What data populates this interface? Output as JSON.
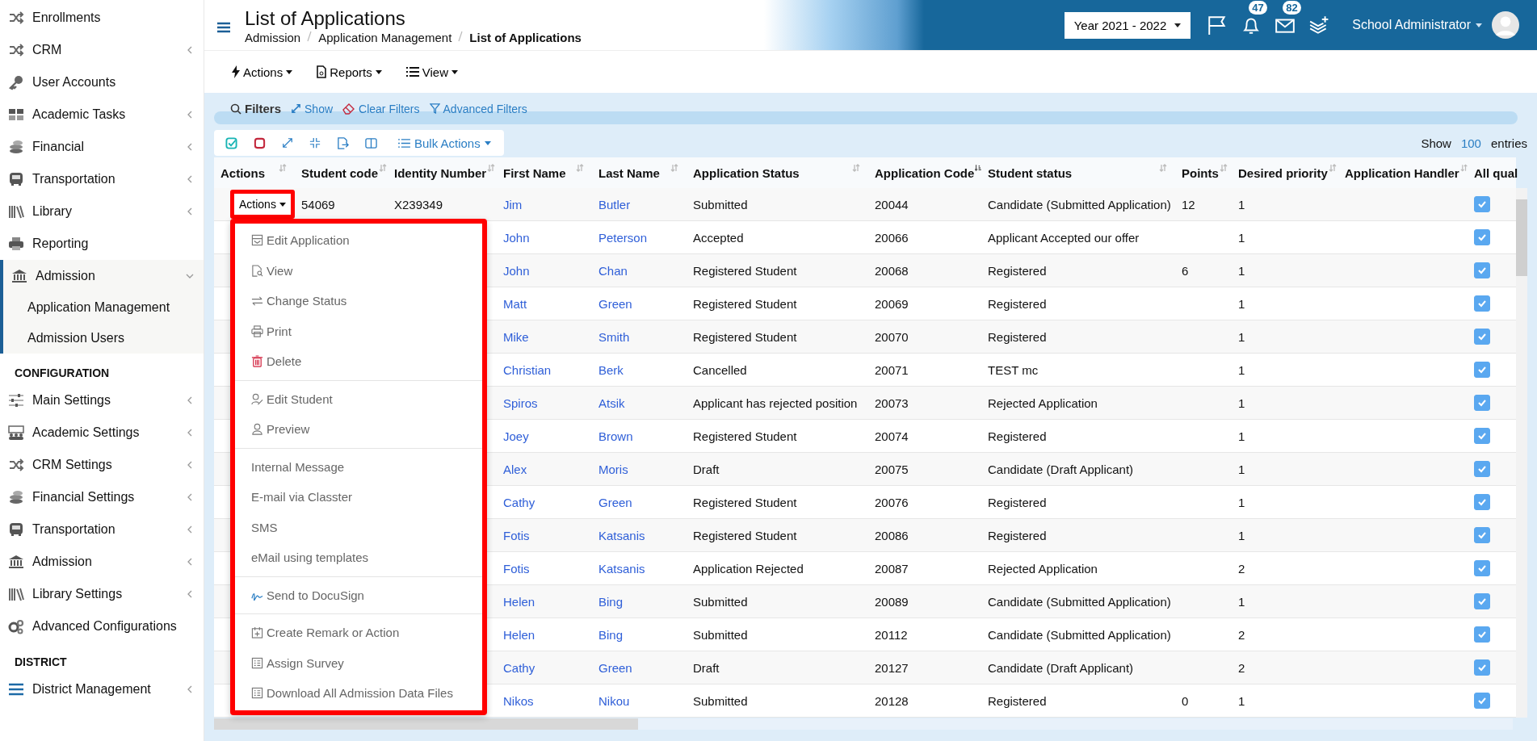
{
  "sidebar": {
    "sections": [
      {
        "items": [
          {
            "label": "Enrollments",
            "kind": "link"
          },
          {
            "label": "CRM",
            "kind": "group",
            "expanded": false
          },
          {
            "label": "User Accounts",
            "kind": "link"
          },
          {
            "label": "Academic Tasks",
            "kind": "group",
            "expanded": false
          },
          {
            "label": "Financial",
            "kind": "group",
            "expanded": false
          },
          {
            "label": "Transportation",
            "kind": "group",
            "expanded": false
          },
          {
            "label": "Library",
            "kind": "group",
            "expanded": false
          },
          {
            "label": "Reporting",
            "kind": "link"
          },
          {
            "label": "Admission",
            "kind": "group",
            "expanded": true,
            "children": [
              {
                "label": "Application Management"
              },
              {
                "label": "Admission Users"
              }
            ]
          }
        ]
      },
      {
        "heading": "CONFIGURATION",
        "items": [
          {
            "label": "Main Settings",
            "kind": "group",
            "expanded": false
          },
          {
            "label": "Academic Settings",
            "kind": "group",
            "expanded": false
          },
          {
            "label": "CRM Settings",
            "kind": "group",
            "expanded": false
          },
          {
            "label": "Financial Settings",
            "kind": "group",
            "expanded": false
          },
          {
            "label": "Transportation",
            "kind": "group",
            "expanded": false
          },
          {
            "label": "Admission",
            "kind": "group",
            "expanded": false
          },
          {
            "label": "Library Settings",
            "kind": "group",
            "expanded": false
          },
          {
            "label": "Advanced Configurations",
            "kind": "link"
          }
        ]
      },
      {
        "heading": "DISTRICT",
        "items": [
          {
            "label": "District Management",
            "kind": "group",
            "expanded": false
          }
        ]
      }
    ]
  },
  "header": {
    "title": "List of Applications",
    "breadcrumb": [
      {
        "label": "Admission",
        "current": false
      },
      {
        "label": "Application Management",
        "current": false
      },
      {
        "label": "List of Applications",
        "current": true
      }
    ],
    "year": "Year 2021 - 2022",
    "notifications": "47",
    "messages": "82",
    "user": "School Administrator"
  },
  "toolbar": [
    "Actions",
    "Reports",
    "View"
  ],
  "filters": {
    "label": "Filters",
    "links": [
      "Show",
      "Clear Filters",
      "Advanced Filters"
    ]
  },
  "bulk_actions": "Bulk Actions",
  "page_size": {
    "before": "Show",
    "value": "100",
    "after": "entries"
  },
  "table": {
    "columns": [
      {
        "label": "Actions",
        "sortable": true,
        "sorted": false
      },
      {
        "label": "Student code",
        "sortable": true,
        "sorted": false
      },
      {
        "label": "Identity Number",
        "sortable": true,
        "sorted": false
      },
      {
        "label": "First Name",
        "sortable": true,
        "sorted": false
      },
      {
        "label": "Last Name",
        "sortable": true,
        "sorted": false
      },
      {
        "label": "Application Status",
        "sortable": true,
        "sorted": false
      },
      {
        "label": "Application Code",
        "sortable": true,
        "sorted": true
      },
      {
        "label": "Student status",
        "sortable": true,
        "sorted": false
      },
      {
        "label": "Points",
        "sortable": true,
        "sorted": false
      },
      {
        "label": "Desired priority",
        "sortable": true,
        "sorted": false
      },
      {
        "label": "Application Handler",
        "sortable": true,
        "sorted": false
      },
      {
        "label": "All qual",
        "sortable": false
      }
    ],
    "rows": [
      {
        "actions_button": "Actions",
        "student_code": "54069",
        "identity_number": "X239349",
        "first_name": "Jim",
        "last_name": "Butler",
        "application_status": "Submitted",
        "application_code": "20044",
        "student_status": "Candidate (Submitted Application)",
        "points": "12",
        "desired_priority": "1",
        "all_qualified": true
      },
      {
        "first_name": "John",
        "last_name": "Peterson",
        "application_status": "Accepted",
        "application_code": "20066",
        "student_status": "Applicant Accepted our offer",
        "desired_priority": "1",
        "all_qualified": true
      },
      {
        "first_name": "John",
        "last_name": "Chan",
        "application_status": "Registered Student",
        "application_code": "20068",
        "student_status": "Registered",
        "points": "6",
        "desired_priority": "1",
        "all_qualified": true
      },
      {
        "first_name": "Matt",
        "last_name": "Green",
        "application_status": "Registered Student",
        "application_code": "20069",
        "student_status": "Registered",
        "desired_priority": "1",
        "all_qualified": true
      },
      {
        "first_name": "Mike",
        "last_name": "Smith",
        "application_status": "Registered Student",
        "application_code": "20070",
        "student_status": "Registered",
        "desired_priority": "1",
        "all_qualified": true
      },
      {
        "first_name": "Christian",
        "last_name": "Berk",
        "application_status": "Cancelled",
        "application_code": "20071",
        "student_status": "TEST mc",
        "desired_priority": "1",
        "all_qualified": true
      },
      {
        "first_name": "Spiros",
        "last_name": "Atsik",
        "application_status": "Applicant has rejected position",
        "application_code": "20073",
        "student_status": "Rejected Application",
        "desired_priority": "1",
        "all_qualified": true
      },
      {
        "first_name": "Joey",
        "last_name": "Brown",
        "application_status": "Registered Student",
        "application_code": "20074",
        "student_status": "Registered",
        "desired_priority": "1",
        "all_qualified": true
      },
      {
        "first_name": "Alex",
        "last_name": "Moris",
        "application_status": "Draft",
        "application_code": "20075",
        "student_status": "Candidate (Draft Applicant)",
        "desired_priority": "1",
        "all_qualified": true
      },
      {
        "first_name": "Cathy",
        "last_name": "Green",
        "application_status": "Registered Student",
        "application_code": "20076",
        "student_status": "Registered",
        "desired_priority": "1",
        "all_qualified": true
      },
      {
        "first_name": "Fotis",
        "last_name": "Katsanis",
        "application_status": "Registered Student",
        "application_code": "20086",
        "student_status": "Registered",
        "desired_priority": "1",
        "all_qualified": true
      },
      {
        "first_name": "Fotis",
        "last_name": "Katsanis",
        "application_status": "Application Rejected",
        "application_code": "20087",
        "student_status": "Rejected Application",
        "desired_priority": "2",
        "all_qualified": true
      },
      {
        "first_name": "Helen",
        "last_name": "Bing",
        "application_status": "Submitted",
        "application_code": "20089",
        "student_status": "Candidate (Submitted Application)",
        "desired_priority": "1",
        "all_qualified": true
      },
      {
        "first_name": "Helen",
        "last_name": "Bing",
        "application_status": "Submitted",
        "application_code": "20112",
        "student_status": "Candidate (Submitted Application)",
        "desired_priority": "2",
        "all_qualified": true
      },
      {
        "first_name": "Cathy",
        "last_name": "Green",
        "application_status": "Draft",
        "application_code": "20127",
        "student_status": "Candidate (Draft Applicant)",
        "desired_priority": "2",
        "all_qualified": true
      },
      {
        "first_name": "Nikos",
        "last_name": "Nikou",
        "application_status": "Submitted",
        "application_code": "20128",
        "student_status": "Registered",
        "points": "0",
        "desired_priority": "1",
        "all_qualified": true
      }
    ]
  },
  "row_menu": {
    "open": true,
    "groups": [
      [
        {
          "label": "Edit Application",
          "icon": true,
          "danger": false
        },
        {
          "label": "View",
          "icon": true,
          "danger": false
        },
        {
          "label": "Change Status",
          "icon": true,
          "danger": false
        },
        {
          "label": "Print",
          "icon": true,
          "danger": false
        },
        {
          "label": "Delete",
          "icon": true,
          "danger": true
        }
      ],
      [
        {
          "label": "Edit Student",
          "icon": true,
          "danger": false
        },
        {
          "label": "Preview",
          "icon": true,
          "danger": false
        }
      ],
      [
        {
          "label": "Internal Message",
          "icon": false
        },
        {
          "label": "E-mail via Classter",
          "icon": false
        },
        {
          "label": "SMS",
          "icon": false
        },
        {
          "label": "eMail using templates",
          "icon": false
        }
      ],
      [
        {
          "label": "Send to DocuSign",
          "icon": true,
          "danger": false
        }
      ],
      [
        {
          "label": "Create Remark or Action",
          "icon": true,
          "danger": false
        },
        {
          "label": "Assign Survey",
          "icon": true,
          "danger": false
        },
        {
          "label": "Download All Admission Data Files",
          "icon": true,
          "danger": false
        }
      ]
    ]
  }
}
